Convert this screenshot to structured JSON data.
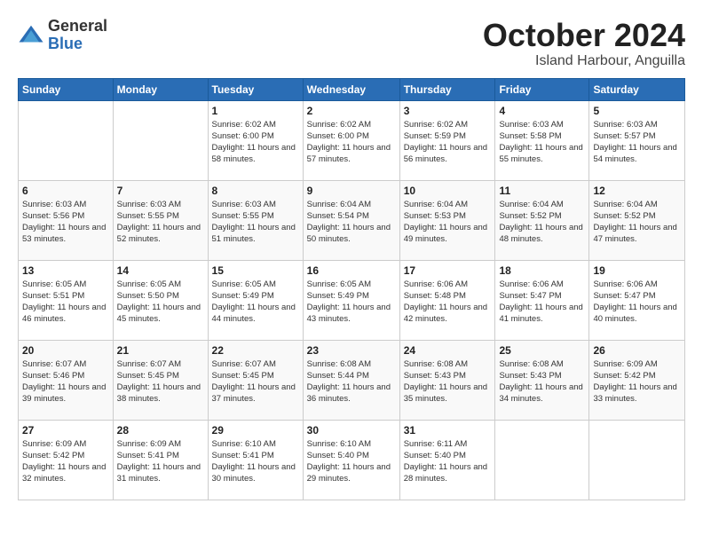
{
  "logo": {
    "general": "General",
    "blue": "Blue"
  },
  "title": "October 2024",
  "subtitle": "Island Harbour, Anguilla",
  "headers": [
    "Sunday",
    "Monday",
    "Tuesday",
    "Wednesday",
    "Thursday",
    "Friday",
    "Saturday"
  ],
  "weeks": [
    [
      {
        "day": "",
        "info": ""
      },
      {
        "day": "",
        "info": ""
      },
      {
        "day": "1",
        "info": "Sunrise: 6:02 AM\nSunset: 6:00 PM\nDaylight: 11 hours and 58 minutes."
      },
      {
        "day": "2",
        "info": "Sunrise: 6:02 AM\nSunset: 6:00 PM\nDaylight: 11 hours and 57 minutes."
      },
      {
        "day": "3",
        "info": "Sunrise: 6:02 AM\nSunset: 5:59 PM\nDaylight: 11 hours and 56 minutes."
      },
      {
        "day": "4",
        "info": "Sunrise: 6:03 AM\nSunset: 5:58 PM\nDaylight: 11 hours and 55 minutes."
      },
      {
        "day": "5",
        "info": "Sunrise: 6:03 AM\nSunset: 5:57 PM\nDaylight: 11 hours and 54 minutes."
      }
    ],
    [
      {
        "day": "6",
        "info": "Sunrise: 6:03 AM\nSunset: 5:56 PM\nDaylight: 11 hours and 53 minutes."
      },
      {
        "day": "7",
        "info": "Sunrise: 6:03 AM\nSunset: 5:55 PM\nDaylight: 11 hours and 52 minutes."
      },
      {
        "day": "8",
        "info": "Sunrise: 6:03 AM\nSunset: 5:55 PM\nDaylight: 11 hours and 51 minutes."
      },
      {
        "day": "9",
        "info": "Sunrise: 6:04 AM\nSunset: 5:54 PM\nDaylight: 11 hours and 50 minutes."
      },
      {
        "day": "10",
        "info": "Sunrise: 6:04 AM\nSunset: 5:53 PM\nDaylight: 11 hours and 49 minutes."
      },
      {
        "day": "11",
        "info": "Sunrise: 6:04 AM\nSunset: 5:52 PM\nDaylight: 11 hours and 48 minutes."
      },
      {
        "day": "12",
        "info": "Sunrise: 6:04 AM\nSunset: 5:52 PM\nDaylight: 11 hours and 47 minutes."
      }
    ],
    [
      {
        "day": "13",
        "info": "Sunrise: 6:05 AM\nSunset: 5:51 PM\nDaylight: 11 hours and 46 minutes."
      },
      {
        "day": "14",
        "info": "Sunrise: 6:05 AM\nSunset: 5:50 PM\nDaylight: 11 hours and 45 minutes."
      },
      {
        "day": "15",
        "info": "Sunrise: 6:05 AM\nSunset: 5:49 PM\nDaylight: 11 hours and 44 minutes."
      },
      {
        "day": "16",
        "info": "Sunrise: 6:05 AM\nSunset: 5:49 PM\nDaylight: 11 hours and 43 minutes."
      },
      {
        "day": "17",
        "info": "Sunrise: 6:06 AM\nSunset: 5:48 PM\nDaylight: 11 hours and 42 minutes."
      },
      {
        "day": "18",
        "info": "Sunrise: 6:06 AM\nSunset: 5:47 PM\nDaylight: 11 hours and 41 minutes."
      },
      {
        "day": "19",
        "info": "Sunrise: 6:06 AM\nSunset: 5:47 PM\nDaylight: 11 hours and 40 minutes."
      }
    ],
    [
      {
        "day": "20",
        "info": "Sunrise: 6:07 AM\nSunset: 5:46 PM\nDaylight: 11 hours and 39 minutes."
      },
      {
        "day": "21",
        "info": "Sunrise: 6:07 AM\nSunset: 5:45 PM\nDaylight: 11 hours and 38 minutes."
      },
      {
        "day": "22",
        "info": "Sunrise: 6:07 AM\nSunset: 5:45 PM\nDaylight: 11 hours and 37 minutes."
      },
      {
        "day": "23",
        "info": "Sunrise: 6:08 AM\nSunset: 5:44 PM\nDaylight: 11 hours and 36 minutes."
      },
      {
        "day": "24",
        "info": "Sunrise: 6:08 AM\nSunset: 5:43 PM\nDaylight: 11 hours and 35 minutes."
      },
      {
        "day": "25",
        "info": "Sunrise: 6:08 AM\nSunset: 5:43 PM\nDaylight: 11 hours and 34 minutes."
      },
      {
        "day": "26",
        "info": "Sunrise: 6:09 AM\nSunset: 5:42 PM\nDaylight: 11 hours and 33 minutes."
      }
    ],
    [
      {
        "day": "27",
        "info": "Sunrise: 6:09 AM\nSunset: 5:42 PM\nDaylight: 11 hours and 32 minutes."
      },
      {
        "day": "28",
        "info": "Sunrise: 6:09 AM\nSunset: 5:41 PM\nDaylight: 11 hours and 31 minutes."
      },
      {
        "day": "29",
        "info": "Sunrise: 6:10 AM\nSunset: 5:41 PM\nDaylight: 11 hours and 30 minutes."
      },
      {
        "day": "30",
        "info": "Sunrise: 6:10 AM\nSunset: 5:40 PM\nDaylight: 11 hours and 29 minutes."
      },
      {
        "day": "31",
        "info": "Sunrise: 6:11 AM\nSunset: 5:40 PM\nDaylight: 11 hours and 28 minutes."
      },
      {
        "day": "",
        "info": ""
      },
      {
        "day": "",
        "info": ""
      }
    ]
  ]
}
